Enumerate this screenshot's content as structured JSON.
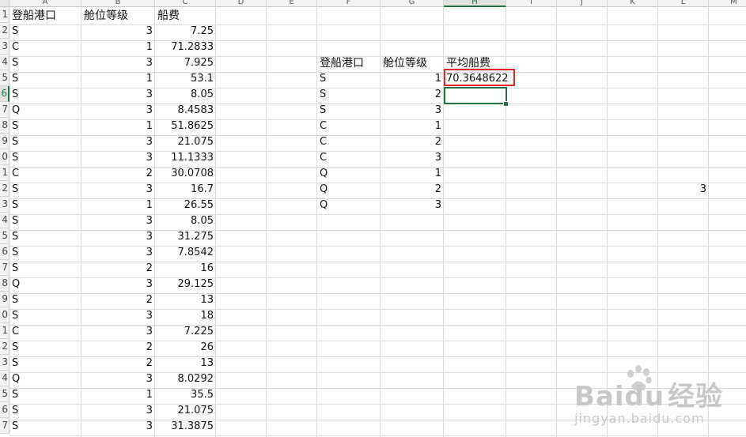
{
  "columns": [
    "A",
    "B",
    "C",
    "D",
    "E",
    "F",
    "G",
    "H",
    "I",
    "J",
    "K",
    "L",
    "M"
  ],
  "selected_column": "H",
  "row_numbers": [
    "1",
    "2",
    "3",
    "4",
    "5",
    "6",
    "7",
    "8",
    "9",
    "0",
    "1",
    "2",
    "3",
    "4",
    "5",
    "6",
    "7",
    "8",
    "9",
    "0",
    "1",
    "2",
    "3",
    "4",
    "5",
    "6",
    "7"
  ],
  "selected_row": "6",
  "table_left": {
    "headers": [
      "登船港口",
      "舱位等级",
      "船费"
    ],
    "rows": [
      [
        "S",
        "3",
        "7.25"
      ],
      [
        "C",
        "1",
        "71.2833"
      ],
      [
        "S",
        "3",
        "7.925"
      ],
      [
        "S",
        "1",
        "53.1"
      ],
      [
        "S",
        "3",
        "8.05"
      ],
      [
        "Q",
        "3",
        "8.4583"
      ],
      [
        "S",
        "1",
        "51.8625"
      ],
      [
        "S",
        "3",
        "21.075"
      ],
      [
        "S",
        "3",
        "11.1333"
      ],
      [
        "C",
        "2",
        "30.0708"
      ],
      [
        "S",
        "3",
        "16.7"
      ],
      [
        "S",
        "1",
        "26.55"
      ],
      [
        "S",
        "3",
        "8.05"
      ],
      [
        "S",
        "3",
        "31.275"
      ],
      [
        "S",
        "3",
        "7.8542"
      ],
      [
        "S",
        "2",
        "16"
      ],
      [
        "Q",
        "3",
        "29.125"
      ],
      [
        "S",
        "2",
        "13"
      ],
      [
        "S",
        "3",
        "18"
      ],
      [
        "C",
        "3",
        "7.225"
      ],
      [
        "S",
        "2",
        "26"
      ],
      [
        "S",
        "2",
        "13"
      ],
      [
        "Q",
        "3",
        "8.0292"
      ],
      [
        "S",
        "1",
        "35.5"
      ],
      [
        "S",
        "3",
        "21.075"
      ],
      [
        "S",
        "3",
        "31.3875"
      ]
    ]
  },
  "table_right": {
    "headers": [
      "登船港口",
      "舱位等级",
      "平均船费"
    ],
    "rows": [
      [
        "S",
        "1",
        "70.3648622"
      ],
      [
        "S",
        "2",
        ""
      ],
      [
        "S",
        "3",
        ""
      ],
      [
        "C",
        "1",
        ""
      ],
      [
        "C",
        "2",
        ""
      ],
      [
        "C",
        "3",
        ""
      ],
      [
        "Q",
        "1",
        ""
      ],
      [
        "Q",
        "2",
        ""
      ],
      [
        "Q",
        "3",
        ""
      ]
    ]
  },
  "stray_cell": {
    "ref": "L12",
    "value": "3"
  },
  "watermark": {
    "brand": "Baidu",
    "brand_cn": "经验",
    "url": "jingyan.baidu.com"
  }
}
